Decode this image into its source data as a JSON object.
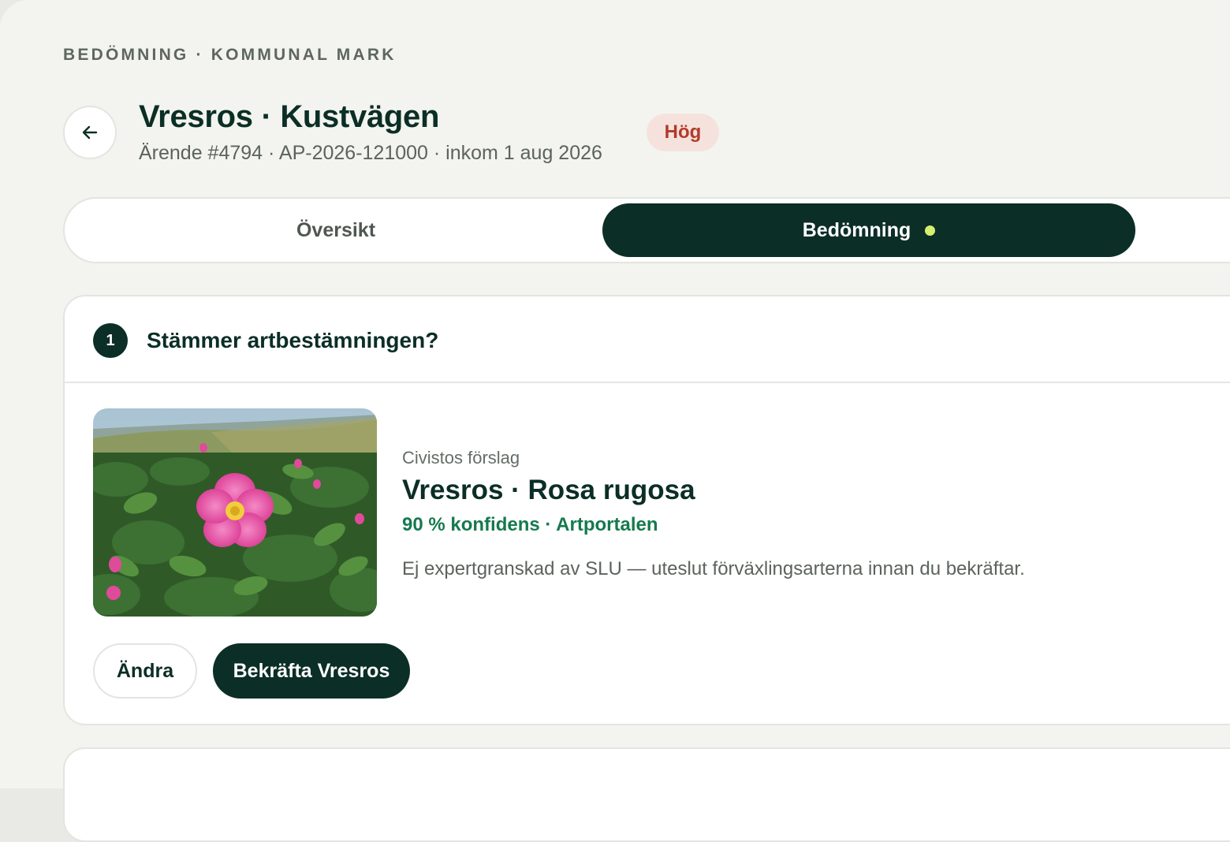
{
  "header": {
    "eyebrow": "BEDÖMNING · KOMMUNAL MARK",
    "title": "Vresros · Kustvägen",
    "subtitle": "Ärende #4794 · AP-2026-121000 · inkom 1 aug 2026",
    "priority": "Hög",
    "back_icon": "arrow-left-icon"
  },
  "tabs": [
    {
      "label": "Översikt",
      "active": false
    },
    {
      "label": "Bedömning",
      "active": true,
      "indicator_color": "#d4f06f"
    }
  ],
  "step": {
    "number": "1",
    "question": "Stämmer artbestämningen?",
    "suggestion_label": "Civistos förslag",
    "species": "Vresros · Rosa rugosa",
    "confidence": "90 % konfidens · Artportalen",
    "note": "Ej expertgranskad av SLU — uteslut förväxlingsarterna innan du bekräftar."
  },
  "actions": {
    "change_label": "Ändra",
    "confirm_label": "Bekräfta Vresros"
  },
  "colors": {
    "primary": "#0b2e26",
    "accent_green": "#157a4e",
    "priority_bg": "#f6e2dd",
    "priority_text": "#b23b2a",
    "background": "#f3f4ef"
  }
}
